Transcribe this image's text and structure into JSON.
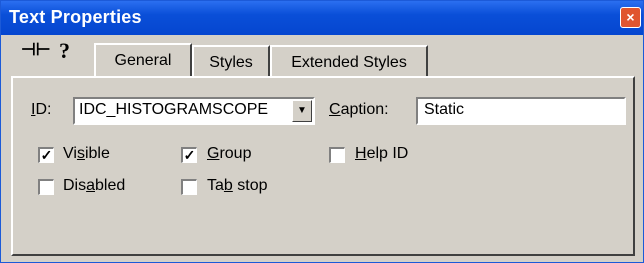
{
  "window": {
    "title": "Text Properties",
    "close_glyph": "×"
  },
  "toolbar": {
    "pin_icon": "pushpin-icon",
    "help_icon": "question-icon",
    "pin_glyph": "⊣⊢",
    "help_glyph": "?"
  },
  "tabs": [
    {
      "label": "General",
      "active": true
    },
    {
      "label": "Styles",
      "active": false
    },
    {
      "label": "Extended Styles",
      "active": false
    }
  ],
  "form": {
    "id_label_pre": "",
    "id_label_u": "I",
    "id_label_post": "D:",
    "id_value": "IDC_HISTOGRAMSCOPE",
    "caption_label_u": "C",
    "caption_label_post": "aption:",
    "caption_value": "Static"
  },
  "checkboxes": {
    "visible": {
      "pre": "Vi",
      "u": "s",
      "post": "ible",
      "checked": true
    },
    "group": {
      "pre": "",
      "u": "G",
      "post": "roup",
      "checked": true
    },
    "help_id": {
      "pre": "",
      "u": "H",
      "post": "elp ID",
      "checked": false
    },
    "disabled": {
      "pre": "Dis",
      "u": "a",
      "post": "bled",
      "checked": false
    },
    "tab_stop": {
      "pre": "Ta",
      "u": "b",
      "post": " stop",
      "checked": false
    }
  },
  "colors": {
    "titlebar": "#0a4fd8",
    "dialog": "#d4d0c8",
    "close": "#e0552f"
  }
}
